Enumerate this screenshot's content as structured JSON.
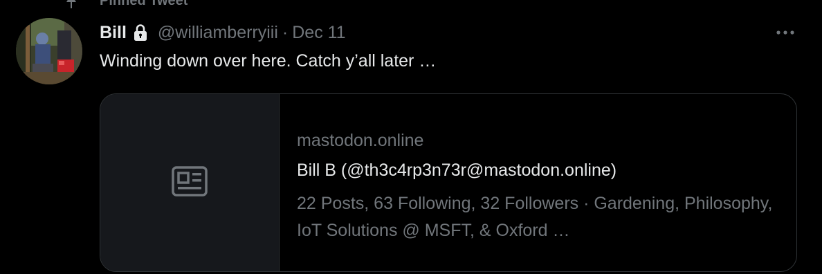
{
  "pinned": {
    "label": "Pinned Tweet",
    "icon": "pin-icon"
  },
  "tweet": {
    "author_name": "Bill",
    "protected_icon": "lock-icon",
    "handle": "@williamberryiii",
    "separator": "·",
    "date": "Dec 11",
    "text": "Winding down over here. Catch y’all later …",
    "more_icon": "more-horizontal-icon"
  },
  "link_card": {
    "thumb_icon": "article-icon",
    "domain": "mastodon.online",
    "title": "Bill B (@th3c4rp3n73r@mastodon.online)",
    "description": "22 Posts, 63 Following, 32 Followers · Gardening, Philosophy, IoT Solutions @ MSFT, & Oxford …"
  },
  "colors": {
    "background": "#000000",
    "primary_text": "#e7e9ea",
    "secondary_text": "#71767b",
    "card_border": "#2f3336",
    "thumb_background": "#16181c"
  }
}
